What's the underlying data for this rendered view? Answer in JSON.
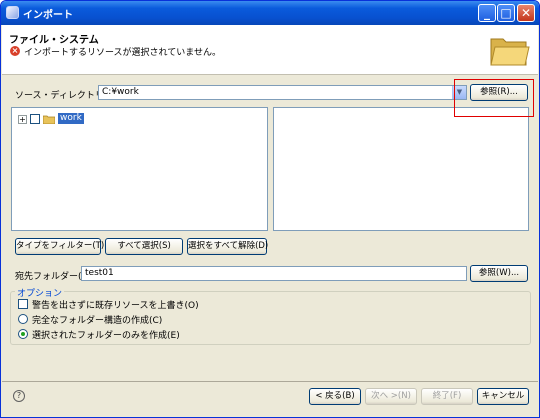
{
  "window": {
    "title": "インポート",
    "controls": {
      "minimize": "_",
      "maximize": "□",
      "close": "✕"
    }
  },
  "header": {
    "title": "ファイル・システム",
    "message": "インポートするリソースが選択されていません。",
    "message_icon": "error-icon",
    "banner_icon": "open-folder-icon"
  },
  "source": {
    "label": "ソース・ディレクトリー(Y):",
    "value": "C:¥work",
    "browse_label": "参照(R)..."
  },
  "tree": {
    "items": [
      {
        "expander": "+",
        "label": "work",
        "checked": false,
        "selected": true
      }
    ]
  },
  "selection_buttons": {
    "filter": "タイプをフィルター(T)...",
    "select_all": "すべて選択(S)",
    "deselect_all": "選択をすべて解除(D)"
  },
  "dest": {
    "label": "宛先フォルダー(L):",
    "value": "test01",
    "browse_label": "参照(W)..."
  },
  "options": {
    "group_label": "オプション",
    "overwrite": {
      "label": "警告を出さずに既存リソースを上書き(O)",
      "checked": false
    },
    "create_full": {
      "label": "完全なフォルダー構造の作成(C)",
      "selected": false
    },
    "create_selected": {
      "label": "選択されたフォルダーのみを作成(E)",
      "selected": true
    }
  },
  "footer": {
    "help": "?",
    "back": "< 戻る(B)",
    "next": "次へ >(N)",
    "finish": "終了(F)",
    "cancel": "キャンセル"
  },
  "colors": {
    "highlight": "#e00000",
    "selection": "#316ac5",
    "titlebar": "#0a5bdc"
  }
}
